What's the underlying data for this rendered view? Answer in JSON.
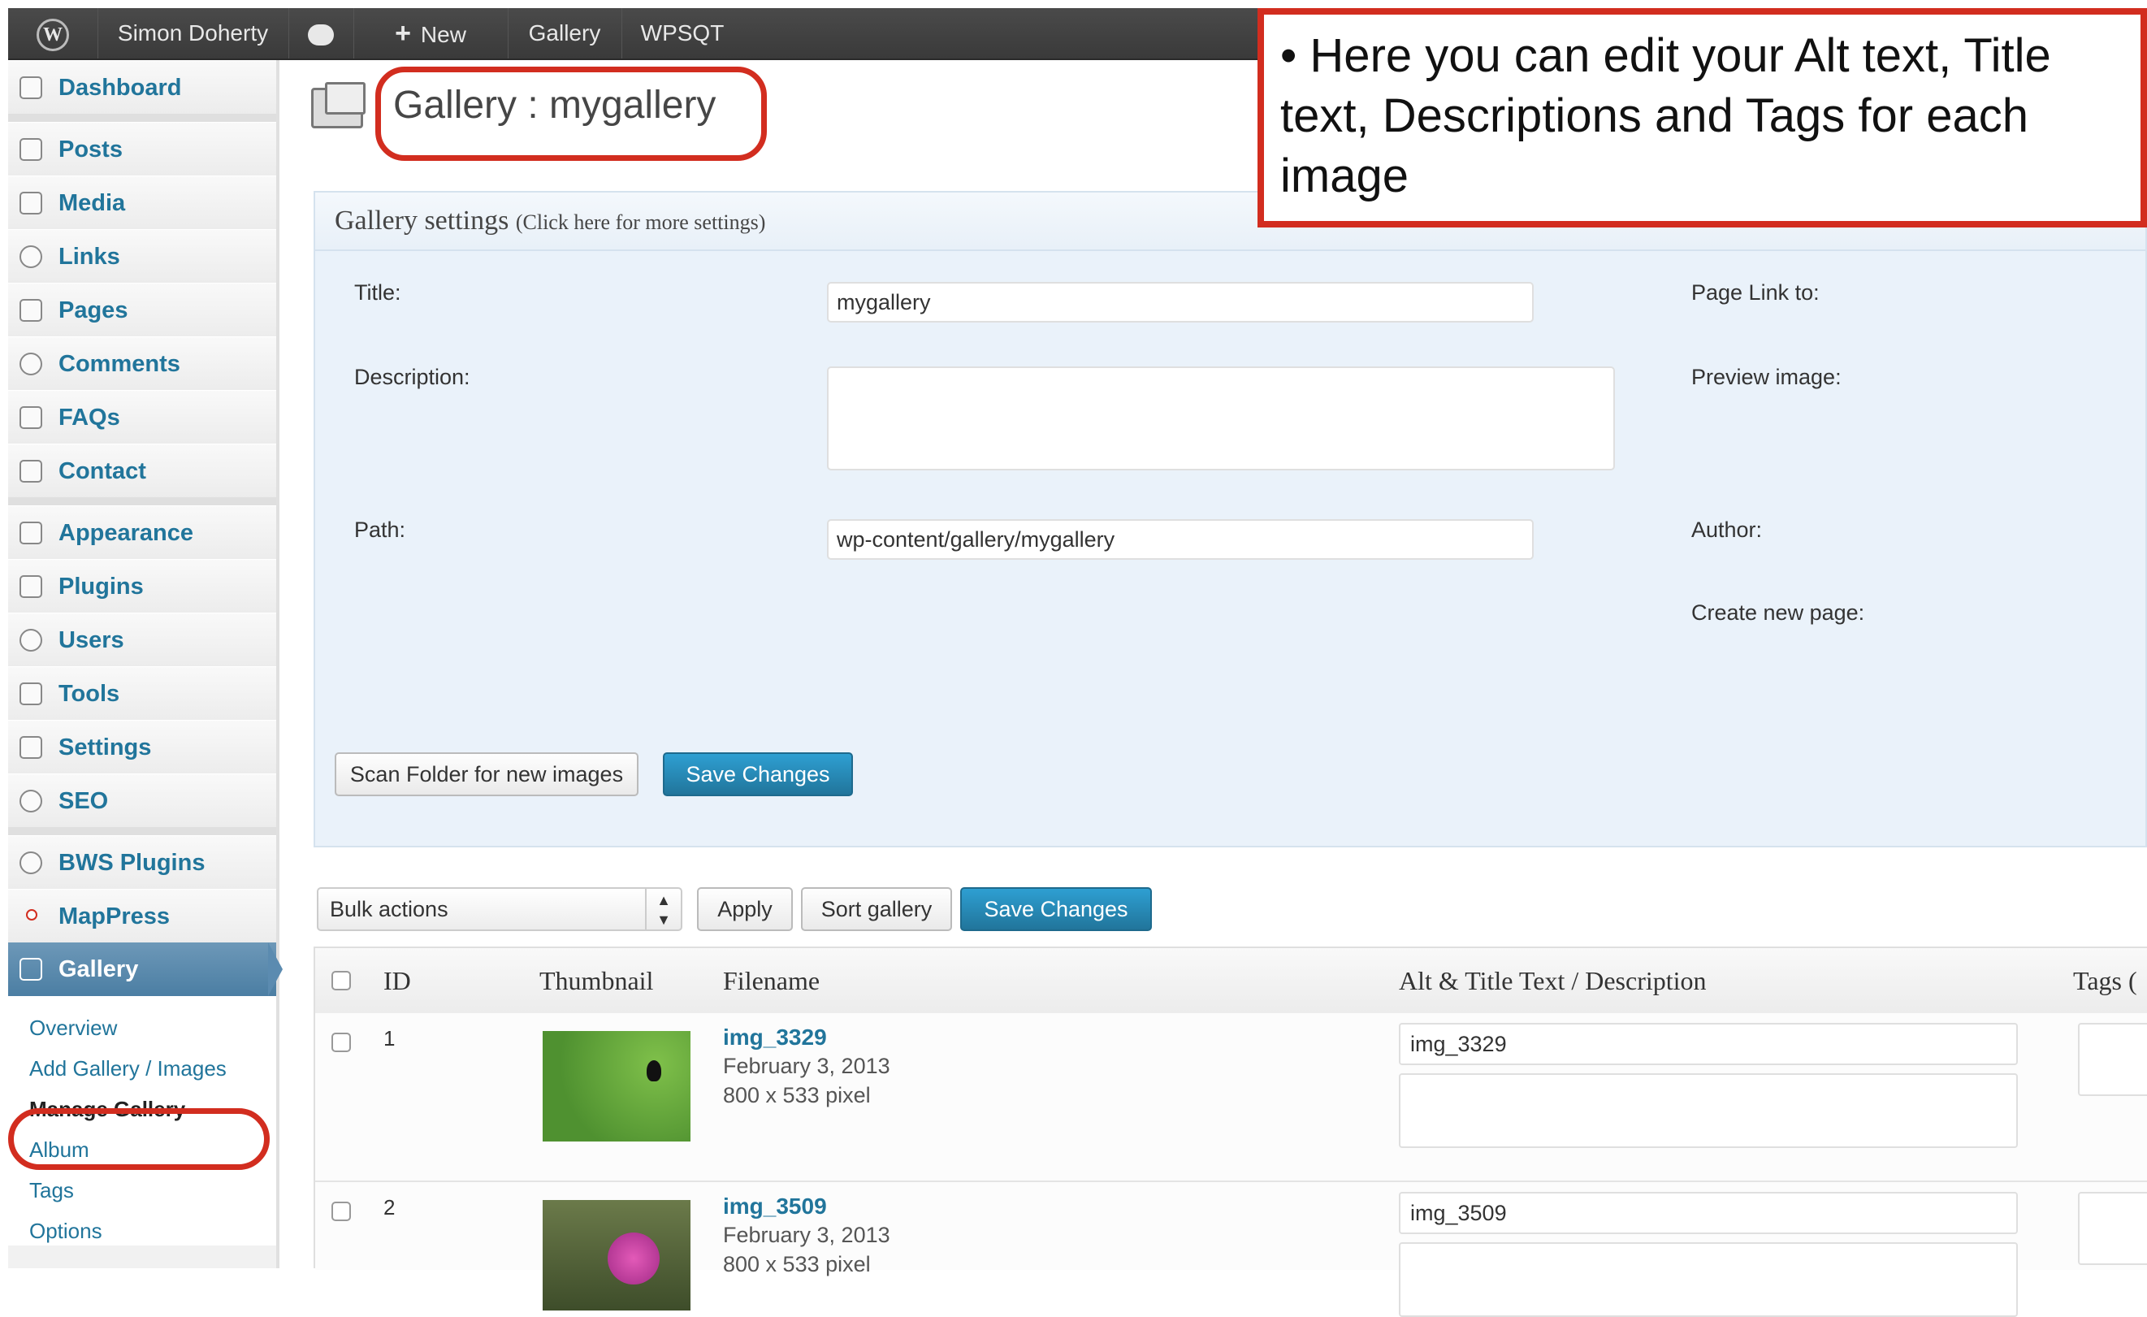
{
  "adminbar": {
    "logo": "W",
    "user": "Simon Doherty",
    "new_label": "New",
    "new_plus": "+",
    "gallery": "Gallery",
    "wpsqt": "WPSQT"
  },
  "sidebar": {
    "items": [
      {
        "label": "Dashboard"
      },
      {
        "label": "Posts"
      },
      {
        "label": "Media"
      },
      {
        "label": "Links"
      },
      {
        "label": "Pages"
      },
      {
        "label": "Comments"
      },
      {
        "label": "FAQs"
      },
      {
        "label": "Contact"
      },
      {
        "label": "Appearance"
      },
      {
        "label": "Plugins"
      },
      {
        "label": "Users"
      },
      {
        "label": "Tools"
      },
      {
        "label": "Settings"
      },
      {
        "label": "SEO"
      },
      {
        "label": "BWS Plugins"
      },
      {
        "label": "MapPress"
      },
      {
        "label": "Gallery"
      }
    ],
    "submenu": [
      {
        "label": "Overview"
      },
      {
        "label": "Add Gallery / Images"
      },
      {
        "label": "Manage Gallery"
      },
      {
        "label": "Album"
      },
      {
        "label": "Tags"
      },
      {
        "label": "Options"
      }
    ]
  },
  "page": {
    "title": "Gallery : mygallery"
  },
  "settings": {
    "heading": "Gallery settings",
    "heading_sub": "(Click here for more settings)",
    "title_label": "Title:",
    "title_value": "mygallery",
    "description_label": "Description:",
    "path_label": "Path:",
    "path_value": "wp-content/gallery/mygallery",
    "page_link_label": "Page Link to:",
    "preview_label": "Preview image:",
    "author_label": "Author:",
    "create_page_label": "Create new page:",
    "scan_button": "Scan Folder for new images",
    "save_button": "Save Changes"
  },
  "bulk": {
    "select_value": "Bulk actions",
    "apply": "Apply",
    "sort": "Sort gallery",
    "save": "Save Changes"
  },
  "table": {
    "headers": {
      "id": "ID",
      "thumbnail": "Thumbnail",
      "filename": "Filename",
      "alt": "Alt & Title Text / Description",
      "tags": "Tags ("
    },
    "rows": [
      {
        "id": "1",
        "filename": "img_3329",
        "date": "February 3, 2013",
        "size": "800 x 533 pixel",
        "alt": "img_3329"
      },
      {
        "id": "2",
        "filename": "img_3509",
        "date": "February 3, 2013",
        "size": "800 x 533 pixel",
        "alt": "img_3509"
      }
    ]
  },
  "callout": {
    "text": "• Here you can edit your Alt text, Title text, Descriptions and Tags for each image"
  },
  "colors": {
    "accent": "#21759b",
    "highlight": "#d22d1f",
    "adminbar": "#464646"
  }
}
